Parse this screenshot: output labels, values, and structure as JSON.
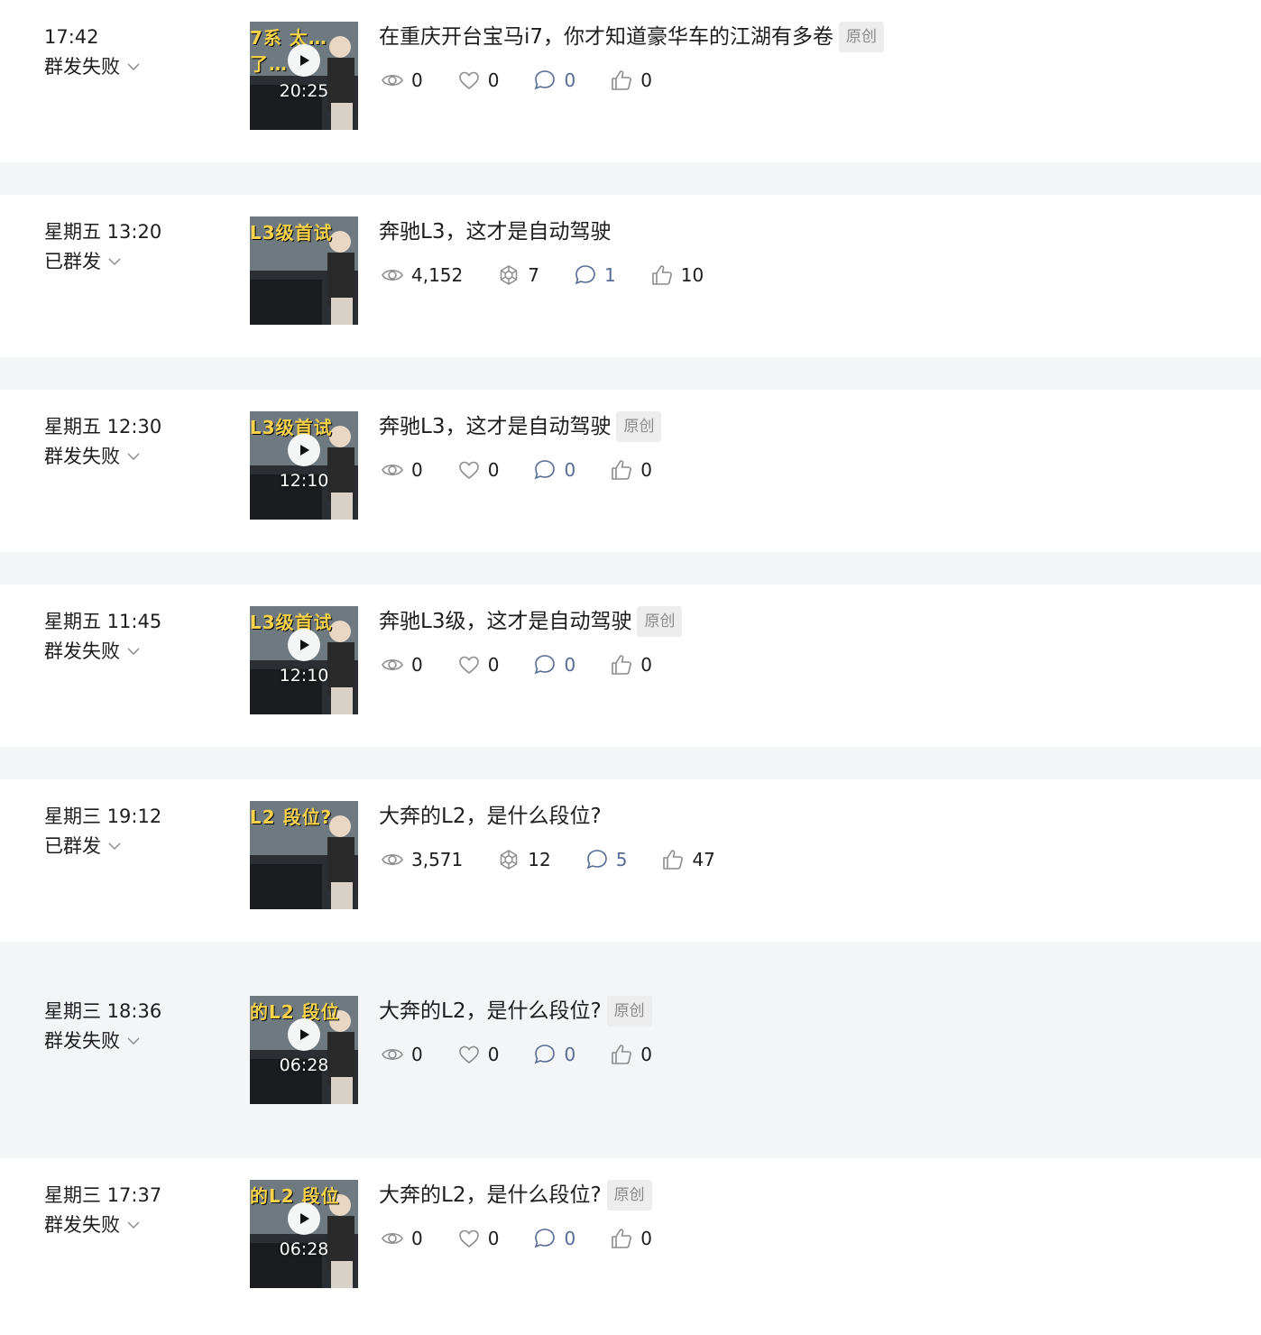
{
  "items": [
    {
      "time": "17:42",
      "status": "群发失败",
      "title": "在重庆开台宝马i7，你才知道豪华车的江湖有多卷",
      "badge": "原创",
      "thumb": {
        "overlay": "7系 太…了…",
        "duration": "20:25",
        "video": true
      },
      "stats": {
        "views": "0",
        "second": "0",
        "comments": "0",
        "likes": "0"
      },
      "second_icon": "heart-icon"
    },
    {
      "time": "星期五 13:20",
      "status": "已群发",
      "title": "奔驰L3，这才是自动驾驶",
      "badge": "",
      "thumb": {
        "overlay": "L3级首试",
        "duration": "",
        "video": false
      },
      "stats": {
        "views": "4,152",
        "second": "7",
        "comments": "1",
        "likes": "10"
      },
      "second_icon": "share-icon"
    },
    {
      "time": "星期五 12:30",
      "status": "群发失败",
      "title": "奔驰L3，这才是自动驾驶",
      "badge": "原创",
      "thumb": {
        "overlay": "L3级首试",
        "duration": "12:10",
        "video": true
      },
      "stats": {
        "views": "0",
        "second": "0",
        "comments": "0",
        "likes": "0"
      },
      "second_icon": "heart-icon"
    },
    {
      "time": "星期五 11:45",
      "status": "群发失败",
      "title": "奔驰L3级，这才是自动驾驶",
      "badge": "原创",
      "thumb": {
        "overlay": "L3级首试",
        "duration": "12:10",
        "video": true
      },
      "stats": {
        "views": "0",
        "second": "0",
        "comments": "0",
        "likes": "0"
      },
      "second_icon": "heart-icon"
    },
    {
      "time": "星期三 19:12",
      "status": "已群发",
      "title": "大奔的L2，是什么段位?",
      "badge": "",
      "thumb": {
        "overlay": "L2 段位?",
        "duration": "",
        "video": false
      },
      "stats": {
        "views": "3,571",
        "second": "12",
        "comments": "5",
        "likes": "47"
      },
      "second_icon": "share-icon"
    },
    {
      "time": "星期三 18:36",
      "status": "群发失败",
      "title": "大奔的L2，是什么段位?",
      "badge": "原创",
      "thumb": {
        "overlay": "的L2 段位",
        "duration": "06:28",
        "video": true
      },
      "stats": {
        "views": "0",
        "second": "0",
        "comments": "0",
        "likes": "0"
      },
      "second_icon": "heart-icon"
    },
    {
      "time": "星期三 17:37",
      "status": "群发失败",
      "title": "大奔的L2，是什么段位?",
      "badge": "原创",
      "thumb": {
        "overlay": "的L2 段位",
        "duration": "06:28",
        "video": true
      },
      "stats": {
        "views": "0",
        "second": "0",
        "comments": "0",
        "likes": "0"
      },
      "second_icon": "heart-icon"
    }
  ],
  "colors": {
    "comment": "#576b95",
    "icon": "#8c8c8c",
    "badge_bg": "#ededed",
    "separator": "#f4f5f7"
  }
}
